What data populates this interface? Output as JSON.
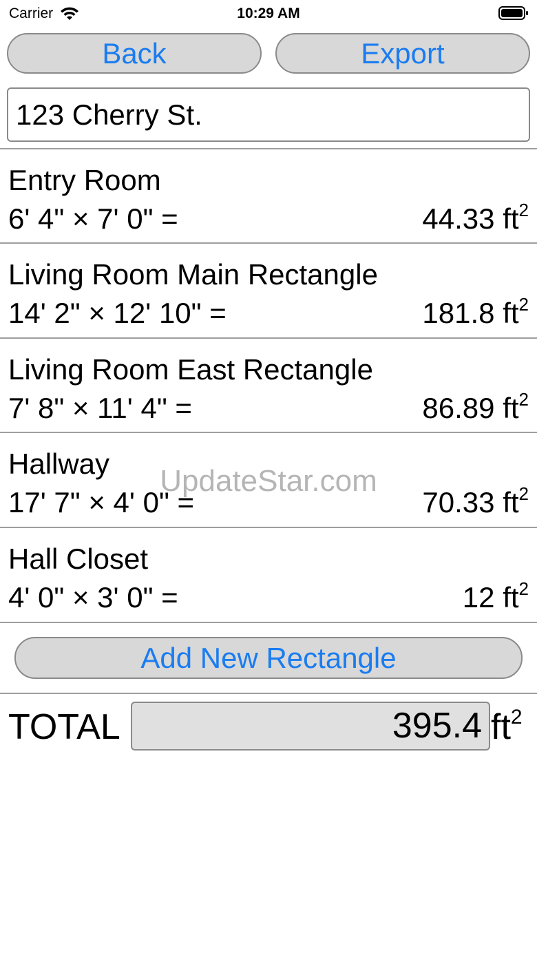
{
  "status_bar": {
    "carrier": "Carrier",
    "time": "10:29 AM",
    "wifi_icon": "wifi-icon",
    "battery_icon": "battery-icon"
  },
  "toolbar": {
    "back_label": "Back",
    "export_label": "Export"
  },
  "address": {
    "value": "123 Cherry St."
  },
  "unit": "ft",
  "unit_exponent": "2",
  "rooms": [
    {
      "name": "Entry Room",
      "dimensions": "6' 4\" × 7' 0\" =",
      "area": "44.33"
    },
    {
      "name": "Living Room Main Rectangle",
      "dimensions": "14' 2\" × 12' 10\" =",
      "area": "181.8"
    },
    {
      "name": "Living Room East Rectangle",
      "dimensions": "7' 8\" × 11' 4\" =",
      "area": "86.89"
    },
    {
      "name": "Hallway",
      "dimensions": "17' 7\" × 4' 0\" =",
      "area": "70.33"
    },
    {
      "name": "Hall Closet",
      "dimensions": "4' 0\" × 3' 0\" =",
      "area": "12"
    }
  ],
  "add_button_label": "Add New Rectangle",
  "total": {
    "label": "TOTAL",
    "value": "395.4"
  },
  "watermark": "UpdateStar.com",
  "colors": {
    "accent": "#1a7cf0",
    "button_fill": "#d8d8d8",
    "border": "#8a8a8a"
  }
}
